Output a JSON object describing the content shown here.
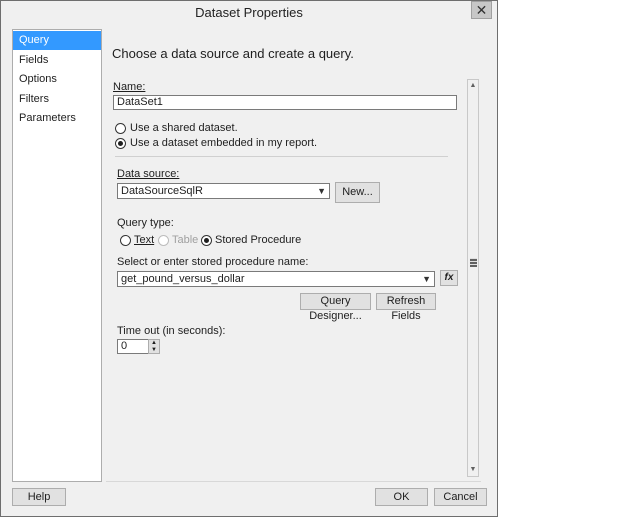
{
  "window": {
    "title": "Dataset Properties",
    "close_glyph": "✕"
  },
  "nav": {
    "items": [
      {
        "label": "Query",
        "selected": true
      },
      {
        "label": "Fields",
        "selected": false
      },
      {
        "label": "Options",
        "selected": false
      },
      {
        "label": "Filters",
        "selected": false
      },
      {
        "label": "Parameters",
        "selected": false
      }
    ]
  },
  "content": {
    "heading": "Choose a data source and create a query.",
    "name_label": "Name:",
    "name_value": "DataSet1",
    "shared_dataset_label": "Use a shared dataset.",
    "embedded_dataset_label": "Use a dataset embedded in my report.",
    "data_source_label": "Data source:",
    "data_source_value": "DataSourceSqlR",
    "new_button": "New...",
    "query_type_label": "Query type:",
    "query_types": {
      "text": "Text",
      "table": "Table",
      "stored_procedure": "Stored Procedure"
    },
    "sp_label": "Select or enter stored procedure name:",
    "sp_value": "get_pound_versus_dollar",
    "fx_glyph": "fx",
    "query_designer_button": "Query Designer...",
    "refresh_fields_button": "Refresh Fields",
    "timeout_label": "Time out (in seconds):",
    "timeout_value": "0"
  },
  "footer": {
    "help_button": "Help",
    "ok_button": "OK",
    "cancel_button": "Cancel"
  },
  "colors": {
    "selection": "#3399ff",
    "window_bg": "#f0f0f0"
  }
}
